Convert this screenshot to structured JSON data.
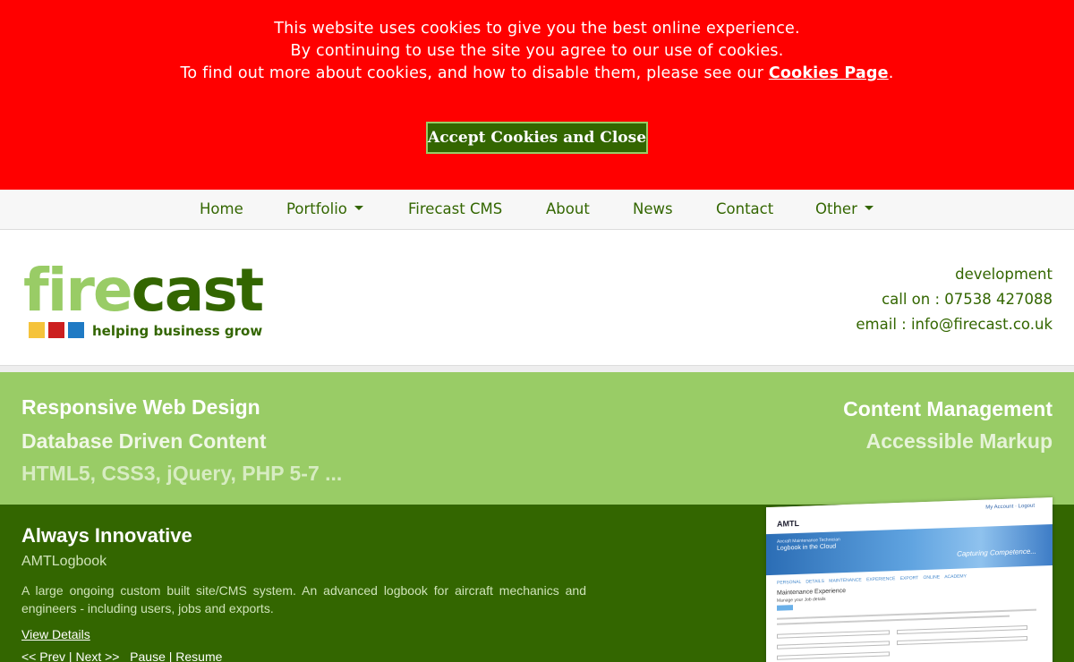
{
  "cookie_banner": {
    "line1": "This website uses cookies to give you the best online experience.",
    "line2": "By continuing to use the site you agree to our use of cookies.",
    "line3_prefix": "To find out more about cookies, and how to disable them, please see our ",
    "link_label": "Cookies Page",
    "line3_suffix": ".",
    "accept_label": "Accept Cookies and Close",
    "background_color": "#ff0000",
    "button_color": "#336600"
  },
  "nav": {
    "items": [
      {
        "label": "Home",
        "has_dropdown": false
      },
      {
        "label": "Portfolio",
        "has_dropdown": true
      },
      {
        "label": "Firecast CMS",
        "has_dropdown": false
      },
      {
        "label": "About",
        "has_dropdown": false
      },
      {
        "label": "News",
        "has_dropdown": false
      },
      {
        "label": "Contact",
        "has_dropdown": false
      },
      {
        "label": "Other",
        "has_dropdown": true
      }
    ]
  },
  "header": {
    "logo_part1": "fire",
    "logo_part2": "cast",
    "tagline": "helping business grow",
    "logo_squares": [
      "#f5c33b",
      "#cc1f1f",
      "#1f7ac4"
    ],
    "contact_line1": "development",
    "contact_line2": "call on : 07538 427088",
    "contact_line3": "email : info@firecast.co.uk"
  },
  "features": {
    "left": [
      {
        "text": "Responsive Web Design",
        "color": "#ffffff"
      },
      {
        "text": "Database Driven Content",
        "color": "#f0f7e6"
      },
      {
        "text": "HTML5, CSS3, jQuery, PHP 5-7 ...",
        "color": "#d7ecc2"
      }
    ],
    "right": [
      {
        "text": "Content Management",
        "color": "#ffffff"
      },
      {
        "text": "Accessible Markup",
        "color": "#e6f3d8"
      }
    ],
    "background_color": "#99cc66"
  },
  "portfolio": {
    "title": "Always Innovative",
    "subtitle": "AMTLogbook",
    "description": "A large ongoing custom built site/CMS system. An advanced logbook for aircraft mechanics and engineers - including users, jobs and exports.",
    "view_details": "View Details",
    "prev": "<< Prev",
    "next": "Next >>",
    "pause": "Pause",
    "resume": "Resume",
    "separator": "|",
    "background_color": "#336600"
  },
  "thumbnail": {
    "logo": "AMTL",
    "account": "My Account · Logout",
    "hero_small": "Aircraft Maintenance Technician",
    "hero_title": "Logbook in the Cloud",
    "hero_tagline": "Capturing Competence...",
    "tabs": "PERSONAL DETAILS  MAINTENANCE EXPERIENCE  EXPORT  ONLINE ACADEMY",
    "heading": "Maintenance Experience",
    "subheading": "Manage your Job details"
  }
}
